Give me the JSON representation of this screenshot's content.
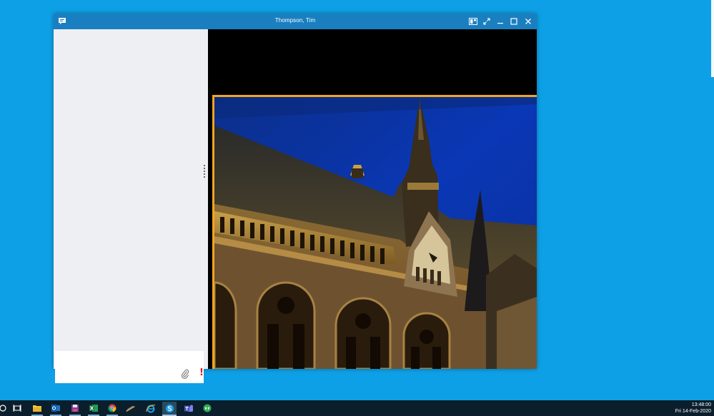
{
  "window": {
    "title": "Thompson, Tim",
    "icons": [
      "chat-icon",
      "layout-icon",
      "fullscreen-icon",
      "minimize-icon",
      "maximize-icon",
      "close-icon"
    ]
  },
  "chat": {
    "compose_icons": [
      "attach-icon",
      "urgent-icon"
    ],
    "urgent_glyph": "!"
  },
  "screen_share": {
    "border_color": "#f2a51f",
    "subject": "illuminated gothic building at night"
  },
  "taskbar": {
    "items": [
      {
        "icon": "search-icon",
        "state": "normal"
      },
      {
        "icon": "task-view-icon",
        "state": "normal"
      },
      {
        "icon": "file-explorer-icon",
        "state": "running"
      },
      {
        "icon": "outlook-icon",
        "state": "running"
      },
      {
        "icon": "save-app-icon",
        "state": "running"
      },
      {
        "icon": "excel-icon",
        "state": "running"
      },
      {
        "icon": "chrome-icon",
        "state": "running"
      },
      {
        "icon": "pen-app-icon",
        "state": "normal"
      },
      {
        "icon": "internet-explorer-icon",
        "state": "normal"
      },
      {
        "icon": "skype-icon",
        "state": "active"
      },
      {
        "icon": "teams-icon",
        "state": "normal"
      },
      {
        "icon": "chat-app-icon",
        "state": "normal"
      }
    ],
    "clock": {
      "time": "13:48:00",
      "date": "Fri 14-Feb-2020"
    }
  },
  "colors": {
    "desktop": "#0ea0e6",
    "titlebar": "#1a7fc0",
    "taskbar": "#0b1e2b",
    "chat_pane": "#eeeff3",
    "share_border": "#f2a51f"
  }
}
